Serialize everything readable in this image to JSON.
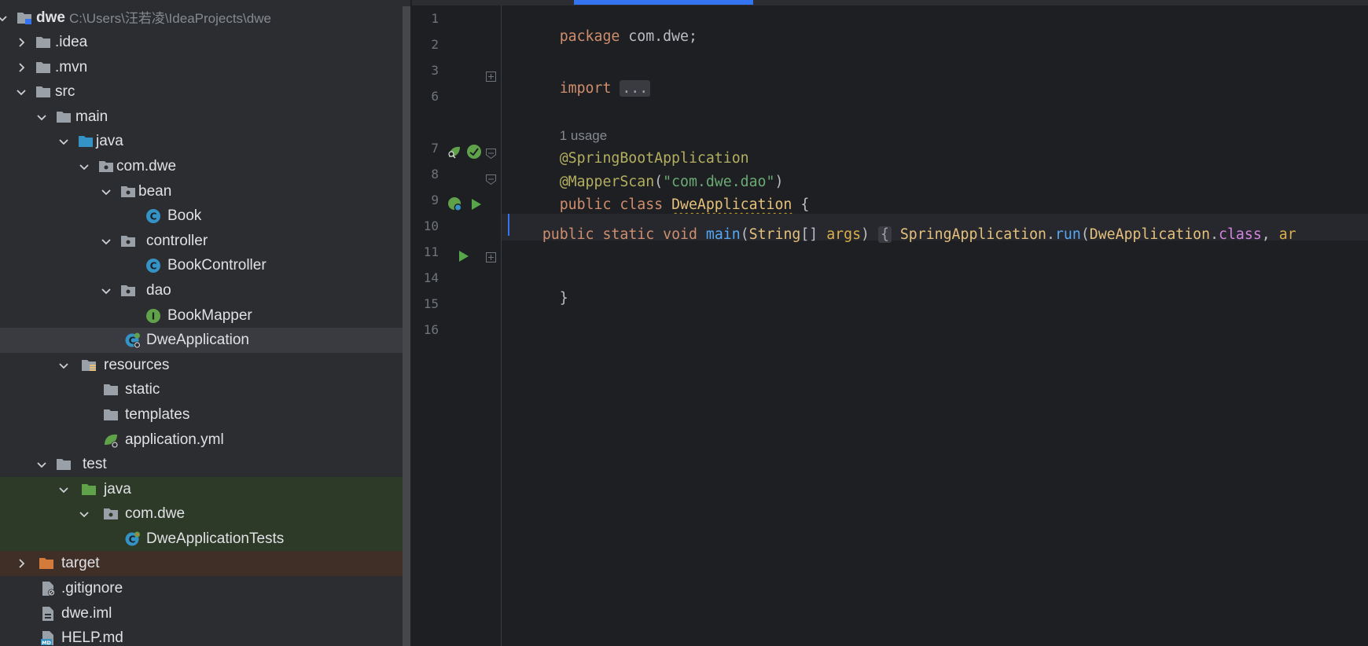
{
  "project": {
    "root_name": "dwe",
    "root_path": "C:\\Users\\汪若凌\\IdeaProjects\\dwe",
    "items": [
      {
        "label": "dwe",
        "name": "tree-item-dwe-root"
      },
      {
        "label": ".idea",
        "name": "tree-item-idea"
      },
      {
        "label": ".mvn",
        "name": "tree-item-mvn"
      },
      {
        "label": "src",
        "name": "tree-item-src"
      },
      {
        "label": "main",
        "name": "tree-item-main"
      },
      {
        "label": "java",
        "name": "tree-item-main-java"
      },
      {
        "label": "com.dwe",
        "name": "tree-item-com-dwe"
      },
      {
        "label": "bean",
        "name": "tree-item-bean"
      },
      {
        "label": "Book",
        "name": "tree-item-book"
      },
      {
        "label": "controller",
        "name": "tree-item-controller"
      },
      {
        "label": "BookController",
        "name": "tree-item-bookcontroller"
      },
      {
        "label": "dao",
        "name": "tree-item-dao"
      },
      {
        "label": "BookMapper",
        "name": "tree-item-bookmapper"
      },
      {
        "label": "DweApplication",
        "name": "tree-item-dweapplication"
      },
      {
        "label": "resources",
        "name": "tree-item-resources"
      },
      {
        "label": "static",
        "name": "tree-item-static"
      },
      {
        "label": "templates",
        "name": "tree-item-templates"
      },
      {
        "label": "application.yml",
        "name": "tree-item-application-yml"
      },
      {
        "label": "test",
        "name": "tree-item-test"
      },
      {
        "label": "java",
        "name": "tree-item-test-java"
      },
      {
        "label": "com.dwe",
        "name": "tree-item-test-com-dwe"
      },
      {
        "label": "DweApplicationTests",
        "name": "tree-item-dweapplicationtests"
      },
      {
        "label": "target",
        "name": "tree-item-target"
      },
      {
        "label": ".gitignore",
        "name": "tree-item-gitignore"
      },
      {
        "label": "dwe.iml",
        "name": "tree-item-dwe-iml"
      },
      {
        "label": "HELP.md",
        "name": "tree-item-help-md"
      }
    ]
  },
  "editor": {
    "line_numbers": [
      "1",
      "2",
      "3",
      "6",
      "",
      "7",
      "8",
      "9",
      "10",
      "11",
      "14",
      "15",
      "16"
    ],
    "usage_hint": "1 usage",
    "code": {
      "l1_kw": "package",
      "l1_rest": " com.dwe;",
      "l3_kw": "import",
      "l3_fold": "...",
      "l7": "@SpringBootApplication",
      "l8_ann": "@MapperScan",
      "l8_open": "(",
      "l8_str": "\"com.dwe.dao\"",
      "l8_close": ")",
      "l9_kw1": "public",
      "l9_kw2": "class",
      "l9_cls": "DweApplication",
      "l9_brace": "{",
      "l11_kw1": "public",
      "l11_kw2": "static",
      "l11_kw3": "void",
      "l11_fn": "main",
      "l11_open": "(",
      "l11_type": "String",
      "l11_arr": "[] ",
      "l11_par": "args",
      "l11_close": ")",
      "l11_fold": "{",
      "l11_cls": "SpringApplication",
      "l11_dot": ".",
      "l11_run": "run",
      "l11_open2": "(",
      "l11_cls2": "DweApplication",
      "l11_dot2": ".",
      "l11_classkw": "class",
      "l11_comma": ", ",
      "l11_trunc": "ar",
      "l15": "}"
    }
  }
}
